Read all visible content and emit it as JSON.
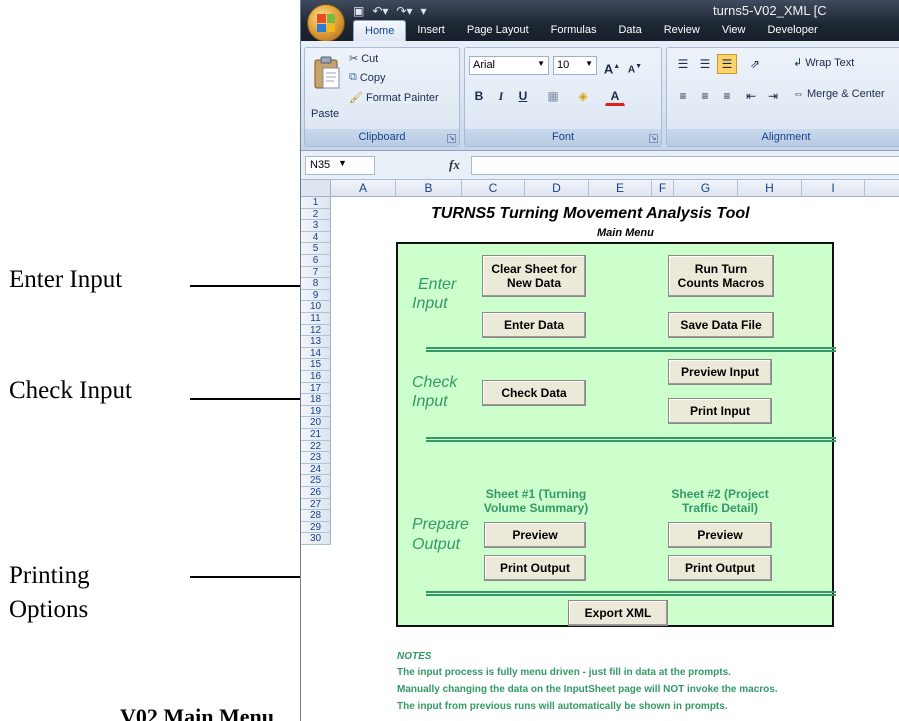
{
  "callouts": {
    "enter_input": "Enter Input",
    "check_input": "Check Input",
    "printing_line1": "Printing",
    "printing_line2": "Options",
    "caption": "V02 Main Menu"
  },
  "window": {
    "title": "turns5-V02_XML  [C"
  },
  "ribbon": {
    "tabs": [
      "Home",
      "Insert",
      "Page Layout",
      "Formulas",
      "Data",
      "Review",
      "View",
      "Developer"
    ],
    "clipboard": {
      "paste": "Paste",
      "cut": "Cut",
      "copy": "Copy",
      "format_painter": "Format Painter",
      "label": "Clipboard"
    },
    "font": {
      "name": "Arial",
      "size": "10",
      "bold": "B",
      "italic": "I",
      "underline": "U",
      "grow": "A",
      "shrink": "A",
      "label": "Font"
    },
    "alignment": {
      "wrap_text": "Wrap Text",
      "merge_center": "Merge & Center",
      "label": "Alignment"
    }
  },
  "formula_bar": {
    "cell_ref": "N35",
    "fx": "fx",
    "value": ""
  },
  "grid": {
    "columns": [
      "A",
      "B",
      "C",
      "D",
      "E",
      "F",
      "G",
      "H",
      "I"
    ],
    "rows": [
      "1",
      "2",
      "3",
      "4",
      "5",
      "6",
      "7",
      "8",
      "9",
      "10",
      "11",
      "12",
      "13",
      "14",
      "15",
      "16",
      "17",
      "18",
      "19",
      "20",
      "21",
      "22",
      "23",
      "24",
      "25",
      "26",
      "27",
      "28",
      "29",
      "30"
    ]
  },
  "sheet": {
    "title": "TURNS5 Turning Movement Analysis Tool",
    "subtitle": "Main Menu",
    "sections": {
      "enter_input_line1": "Enter",
      "enter_input_line2": "Input",
      "check_input_line1": "Check",
      "check_input_line2": "Input",
      "prepare_output_line1": "Prepare",
      "prepare_output_line2": "Output"
    },
    "buttons": {
      "clear_sheet_line1": "Clear Sheet for",
      "clear_sheet_line2": "New Data",
      "run_turn_line1": "Run Turn",
      "run_turn_line2": "Counts Macros",
      "enter_data": "Enter Data",
      "save_data_file": "Save Data File",
      "check_data": "Check Data",
      "preview_input": "Preview Input",
      "print_input": "Print Input",
      "preview_1": "Preview",
      "print_output_1": "Print Output",
      "preview_2": "Preview",
      "print_output_2": "Print Output",
      "export_xml": "Export XML"
    },
    "sheet1_line1": "Sheet #1 (Turning",
    "sheet1_line2": "Volume Summary)",
    "sheet2_line1": "Sheet #2 (Project",
    "sheet2_line2": "Traffic Detail)",
    "notes": {
      "heading": "NOTES",
      "lines": [
        "The input process is fully menu driven - just fill in data at the prompts.",
        "Manually changing the data on the InputSheet page will NOT invoke the macros.",
        "The input from previous runs will automatically be shown in prompts."
      ]
    }
  },
  "colors": {
    "panel_bg": "#ccffcc",
    "accent_green": "#339966",
    "button_face": "#ece9d8"
  }
}
